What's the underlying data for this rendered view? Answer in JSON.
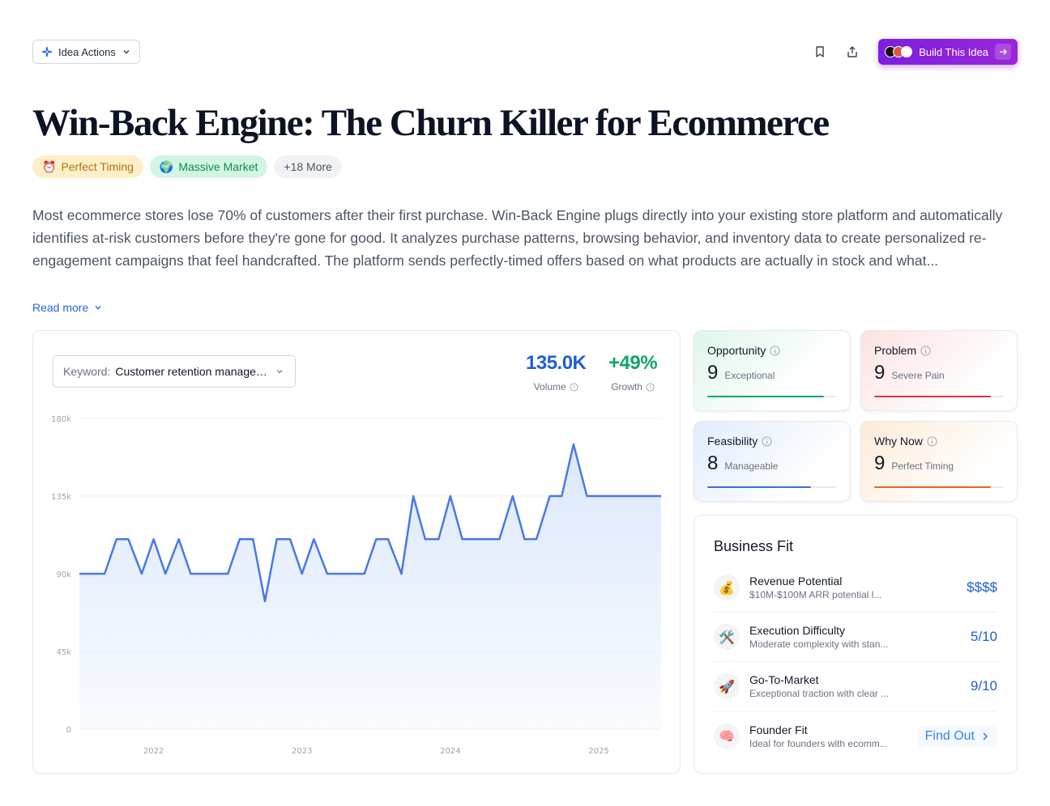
{
  "header": {
    "idea_actions_label": "Idea Actions",
    "build_label": "Build This Idea",
    "brand_color": "#7c1fe0"
  },
  "title": "Win-Back Engine: The Churn Killer for Ecommerce",
  "tags": [
    {
      "emoji": "⏰",
      "label": "Perfect Timing"
    },
    {
      "emoji": "🌍",
      "label": "Massive Market"
    },
    {
      "label": "+18 More"
    }
  ],
  "description": "Most ecommerce stores lose 70% of customers after their first purchase. Win-Back Engine plugs directly into your existing store platform and automatically identifies at-risk customers before they're gone for good. It analyzes purchase patterns, browsing behavior, and inventory data to create personalized re-engagement campaigns that feel handcrafted. The platform sends perfectly-timed offers based on what products are actually in stock and what...",
  "read_more": "Read more",
  "trend": {
    "keyword_label": "Keyword:",
    "keyword_value": "Customer retention management",
    "volume": "135.0K",
    "volume_label": "Volume",
    "growth": "+49%",
    "growth_label": "Growth"
  },
  "chart_data": {
    "type": "area",
    "ytick_labels": [
      "0",
      "45k",
      "90k",
      "135k",
      "180k"
    ],
    "ylim": [
      0,
      180
    ],
    "x_tick_labels": [
      "2022",
      "2023",
      "2024",
      "2025"
    ],
    "x_tick_positions": [
      2022,
      2023,
      2024,
      2025
    ],
    "xlim": [
      2021.5,
      2025.42
    ],
    "x": [
      2021.5,
      2021.67,
      2021.75,
      2021.83,
      2021.92,
      2022.0,
      2022.08,
      2022.17,
      2022.25,
      2022.5,
      2022.58,
      2022.67,
      2022.75,
      2022.83,
      2022.92,
      2023.0,
      2023.08,
      2023.17,
      2023.25,
      2023.42,
      2023.5,
      2023.58,
      2023.67,
      2023.75,
      2023.83,
      2023.92,
      2024.0,
      2024.08,
      2024.17,
      2024.25,
      2024.33,
      2024.42,
      2024.5,
      2024.58,
      2024.67,
      2024.75,
      2024.83,
      2024.92,
      2025.0,
      2025.08,
      2025.17,
      2025.25,
      2025.42
    ],
    "values": [
      90,
      90,
      110,
      110,
      90,
      110,
      90,
      110,
      90,
      90,
      110,
      110,
      74,
      110,
      110,
      90,
      110,
      90,
      90,
      90,
      110,
      110,
      90,
      135,
      110,
      110,
      135,
      110,
      110,
      110,
      110,
      135,
      110,
      110,
      135,
      135,
      165,
      135,
      135,
      135,
      135,
      135,
      135
    ],
    "line_color": "#4a78e8",
    "fill_color": "#dbe8fb",
    "grid": true
  },
  "scores": [
    {
      "label": "Opportunity",
      "value": "9",
      "rating": "Exceptional",
      "fraction": 0.9,
      "color": "#10a56a"
    },
    {
      "label": "Problem",
      "value": "9",
      "rating": "Severe Pain",
      "fraction": 0.9,
      "color": "#e0333a"
    },
    {
      "label": "Feasibility",
      "value": "8",
      "rating": "Manageable",
      "fraction": 0.8,
      "color": "#3b6fd6"
    },
    {
      "label": "Why Now",
      "value": "9",
      "rating": "Perfect Timing",
      "fraction": 0.9,
      "color": "#e8622a"
    }
  ],
  "business_fit": {
    "title": "Business Fit",
    "rows": [
      {
        "icon": "💰",
        "name": "Revenue Potential",
        "desc": "$10M-$100M ARR potential l...",
        "value": "$$$$"
      },
      {
        "icon": "🛠️",
        "name": "Execution Difficulty",
        "desc": "Moderate complexity with stan...",
        "value": "5/10"
      },
      {
        "icon": "🚀",
        "name": "Go-To-Market",
        "desc": "Exceptional traction with clear ...",
        "value": "9/10"
      },
      {
        "icon": "🧠",
        "name": "Founder Fit",
        "desc": "Ideal for founders with ecomm...",
        "link": "Find Out"
      }
    ]
  }
}
